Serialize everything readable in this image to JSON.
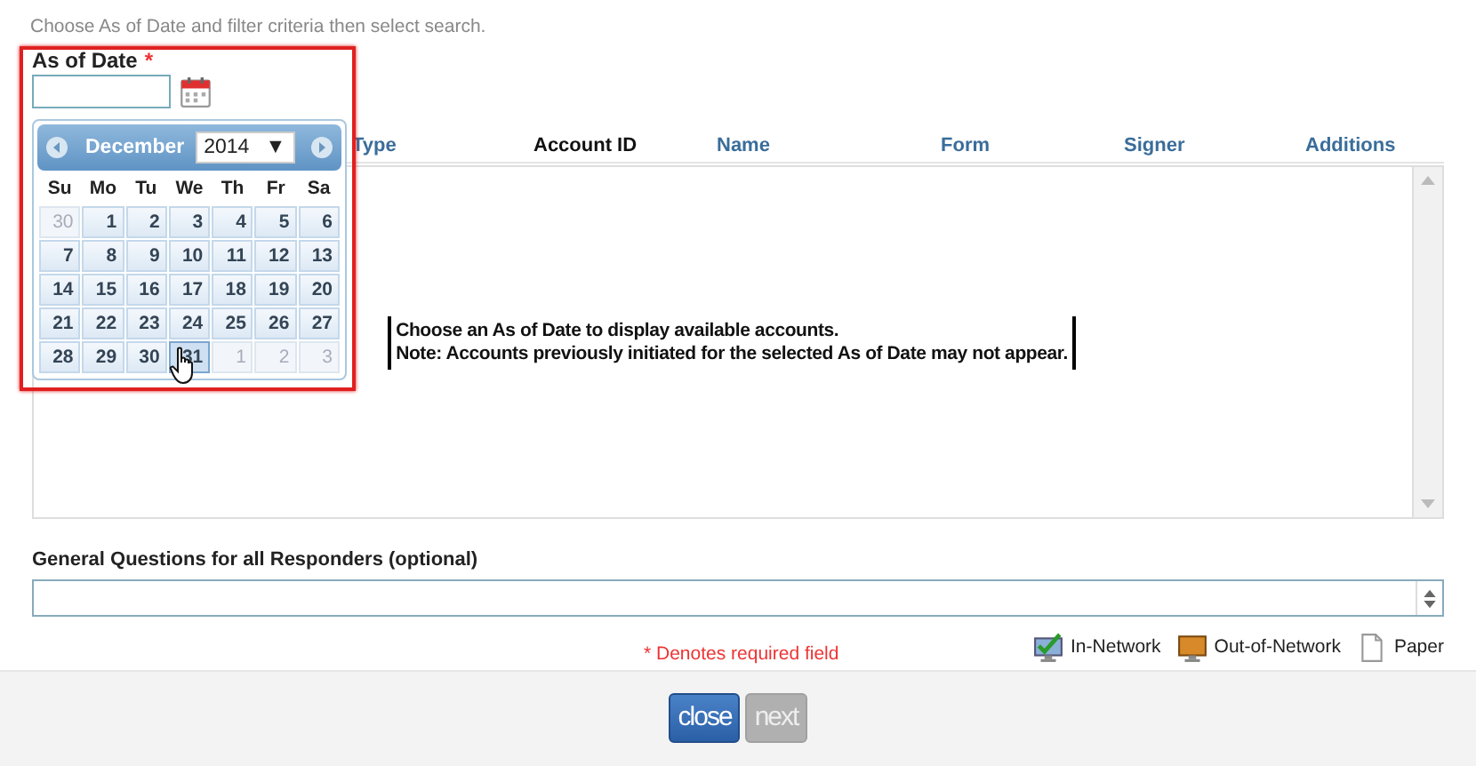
{
  "hint": "Choose As of Date and filter criteria then select search.",
  "as_of_date": {
    "label": "As of Date",
    "required_mark": "*"
  },
  "calendar": {
    "month": "December",
    "year": "2014",
    "year_caret": "▼",
    "weekdays": [
      "Su",
      "Mo",
      "Tu",
      "We",
      "Th",
      "Fr",
      "Sa"
    ],
    "weeks": [
      [
        {
          "day": "30",
          "other_month": true,
          "hovered": false
        },
        {
          "day": "1",
          "other_month": false,
          "hovered": false
        },
        {
          "day": "2",
          "other_month": false,
          "hovered": false
        },
        {
          "day": "3",
          "other_month": false,
          "hovered": false
        },
        {
          "day": "4",
          "other_month": false,
          "hovered": false
        },
        {
          "day": "5",
          "other_month": false,
          "hovered": false
        },
        {
          "day": "6",
          "other_month": false,
          "hovered": false
        }
      ],
      [
        {
          "day": "7",
          "other_month": false,
          "hovered": false
        },
        {
          "day": "8",
          "other_month": false,
          "hovered": false
        },
        {
          "day": "9",
          "other_month": false,
          "hovered": false
        },
        {
          "day": "10",
          "other_month": false,
          "hovered": false
        },
        {
          "day": "11",
          "other_month": false,
          "hovered": false
        },
        {
          "day": "12",
          "other_month": false,
          "hovered": false
        },
        {
          "day": "13",
          "other_month": false,
          "hovered": false
        }
      ],
      [
        {
          "day": "14",
          "other_month": false,
          "hovered": false
        },
        {
          "day": "15",
          "other_month": false,
          "hovered": false
        },
        {
          "day": "16",
          "other_month": false,
          "hovered": false
        },
        {
          "day": "17",
          "other_month": false,
          "hovered": false
        },
        {
          "day": "18",
          "other_month": false,
          "hovered": false
        },
        {
          "day": "19",
          "other_month": false,
          "hovered": false
        },
        {
          "day": "20",
          "other_month": false,
          "hovered": false
        }
      ],
      [
        {
          "day": "21",
          "other_month": false,
          "hovered": false
        },
        {
          "day": "22",
          "other_month": false,
          "hovered": false
        },
        {
          "day": "23",
          "other_month": false,
          "hovered": false
        },
        {
          "day": "24",
          "other_month": false,
          "hovered": false
        },
        {
          "day": "25",
          "other_month": false,
          "hovered": false
        },
        {
          "day": "26",
          "other_month": false,
          "hovered": false
        },
        {
          "day": "27",
          "other_month": false,
          "hovered": false
        }
      ],
      [
        {
          "day": "28",
          "other_month": false,
          "hovered": false
        },
        {
          "day": "29",
          "other_month": false,
          "hovered": false
        },
        {
          "day": "30",
          "other_month": false,
          "hovered": false
        },
        {
          "day": "31",
          "other_month": false,
          "hovered": true
        },
        {
          "day": "1",
          "other_month": true,
          "hovered": false
        },
        {
          "day": "2",
          "other_month": true,
          "hovered": false
        },
        {
          "day": "3",
          "other_month": true,
          "hovered": false
        }
      ]
    ]
  },
  "table": {
    "columns": [
      {
        "label": "Type",
        "sorted": false
      },
      {
        "label": "Account ID",
        "sorted": true
      },
      {
        "label": "Name",
        "sorted": false
      },
      {
        "label": "Form",
        "sorted": false
      },
      {
        "label": "Signer",
        "sorted": false
      },
      {
        "label": "Additions",
        "sorted": false
      }
    ],
    "empty_message": [
      "Choose an As of Date to display available accounts.",
      "Note: Accounts previously initiated for the selected As of Date may not appear."
    ]
  },
  "general_questions": {
    "label": "General Questions for all Responders (optional)"
  },
  "required_note": "* Denotes required field",
  "legend": [
    {
      "kind": "in-network",
      "label": "In-Network"
    },
    {
      "kind": "out-of-network",
      "label": "Out-of-Network"
    },
    {
      "kind": "paper",
      "label": "Paper"
    }
  ],
  "buttons": [
    {
      "label": "close",
      "disabled": false
    },
    {
      "label": "next",
      "disabled": true
    }
  ]
}
